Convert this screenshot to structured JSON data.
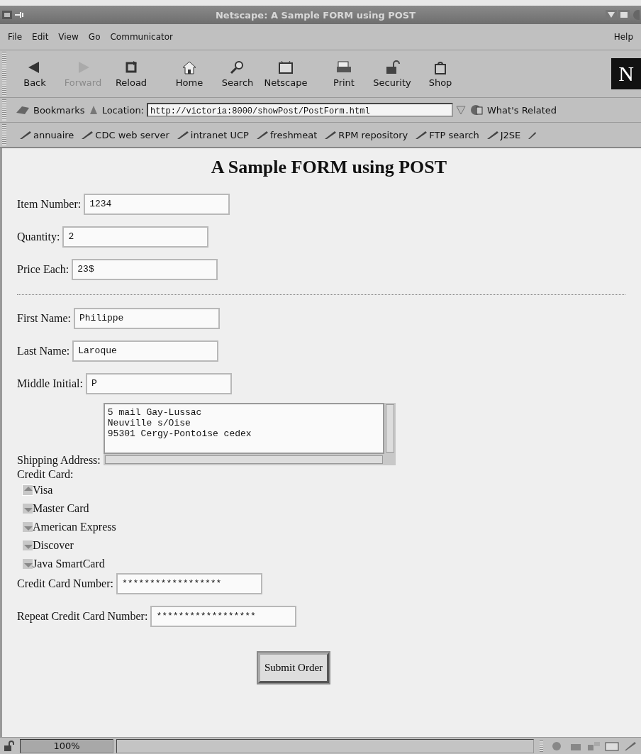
{
  "window": {
    "title": "Netscape: A Sample FORM using POST"
  },
  "menu": {
    "items": [
      "File",
      "Edit",
      "View",
      "Go",
      "Communicator"
    ],
    "help": "Help"
  },
  "toolbar": [
    {
      "label": "Back",
      "disabled": false
    },
    {
      "label": "Forward",
      "disabled": true
    },
    {
      "label": "Reload",
      "disabled": false
    },
    {
      "label": "Home",
      "disabled": false
    },
    {
      "label": "Search",
      "disabled": false
    },
    {
      "label": "Netscape",
      "disabled": false
    },
    {
      "label": "Print",
      "disabled": false
    },
    {
      "label": "Security",
      "disabled": false
    },
    {
      "label": "Shop",
      "disabled": false
    }
  ],
  "logo": "N",
  "location_bar": {
    "bookmarks": "Bookmarks",
    "label": "Location:",
    "url": "http://victoria:8000/showPost/PostForm.html",
    "related": "What's Related"
  },
  "personal_bar": [
    "annuaire",
    "CDC web server",
    "intranet UCP",
    "freshmeat",
    "RPM repository",
    "FTP search",
    "J2SE"
  ],
  "page": {
    "heading": "A Sample FORM using POST",
    "order_fields": [
      {
        "label": "Item Number:",
        "value": "1234"
      },
      {
        "label": "Quantity:",
        "value": "2"
      },
      {
        "label": "Price Each:",
        "value": "23$"
      }
    ],
    "name_fields": [
      {
        "label": "First Name:",
        "value": "Philippe"
      },
      {
        "label": "Last Name:",
        "value": "Laroque"
      },
      {
        "label": "Middle Initial:",
        "value": "P"
      }
    ],
    "address": {
      "label": "Shipping Address:",
      "lines": [
        "5 mail Gay-Lussac",
        "Neuville s/Oise",
        "95301 Cergy-Pontoise cedex"
      ]
    },
    "credit_card": {
      "label": "Credit Card:",
      "options": [
        {
          "label": "Visa",
          "selected": true
        },
        {
          "label": "Master Card",
          "selected": false
        },
        {
          "label": "American Express",
          "selected": false
        },
        {
          "label": "Discover",
          "selected": false
        },
        {
          "label": "Java SmartCard",
          "selected": false
        }
      ]
    },
    "card_fields": [
      {
        "label": "Credit Card Number:",
        "value": "******************"
      },
      {
        "label": "Repeat Credit Card Number:",
        "value": "******************"
      }
    ],
    "submit": "Submit Order"
  },
  "status_bar": {
    "zoom": "100%"
  }
}
